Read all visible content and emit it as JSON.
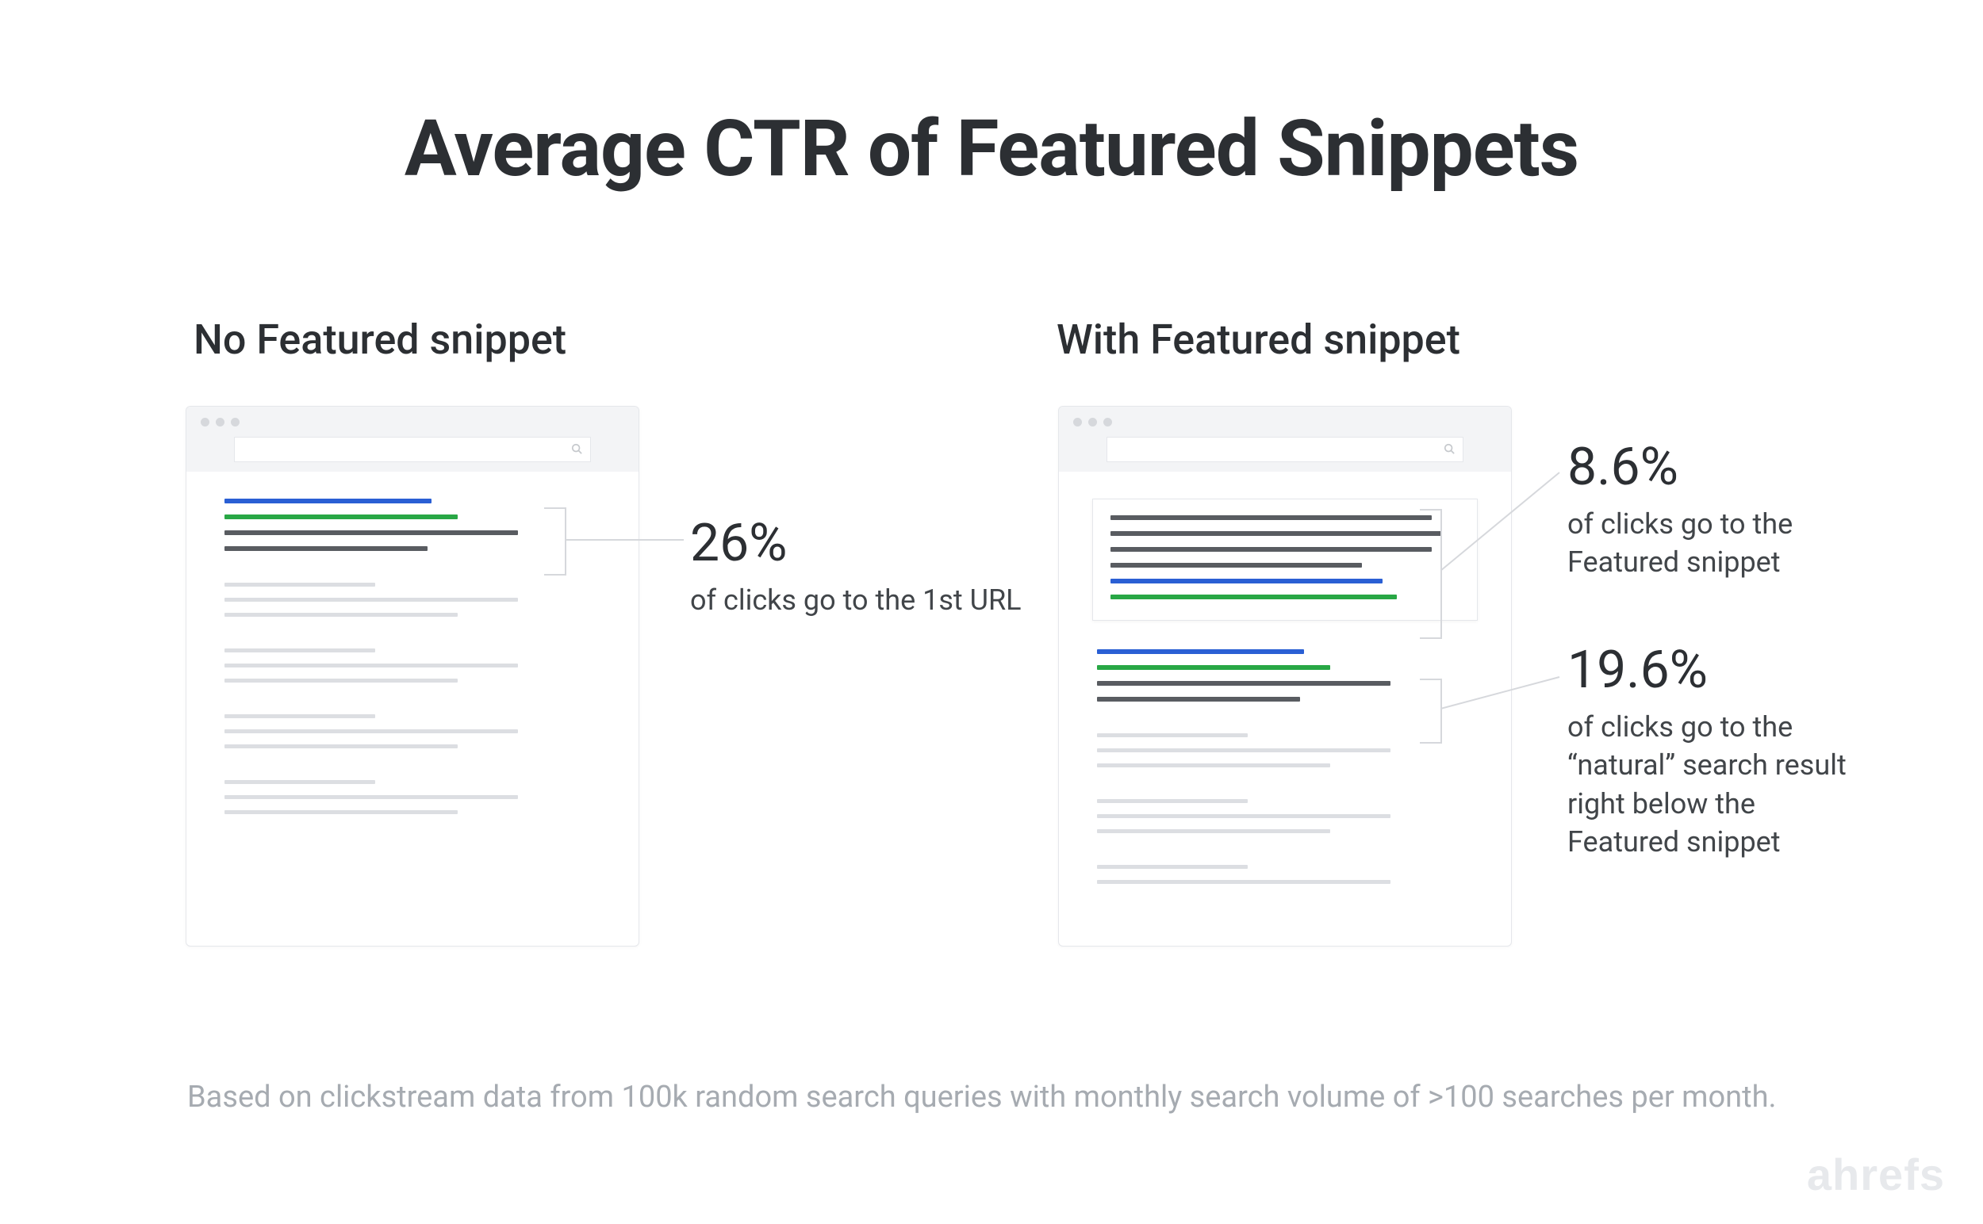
{
  "title": "Average CTR of Featured Snippets",
  "left": {
    "label": "No Featured snippet",
    "callout": {
      "value": "26%",
      "desc": "of clicks go to the 1st URL"
    }
  },
  "right": {
    "label": "With Featured snippet",
    "callout_top": {
      "value": "8.6%",
      "desc": "of clicks go to the Featured snippet"
    },
    "callout_bottom": {
      "value": "19.6%",
      "desc": "of clicks go to the “natural” search result right below the Featured snippet"
    }
  },
  "footnote": "Based on clickstream data from 100k random search queries with monthly search volume of >100 searches per month.",
  "brand": "ahrefs",
  "chart_data": {
    "type": "bar",
    "title": "Average CTR of Featured Snippets",
    "series": [
      {
        "name": "No Featured snippet",
        "items": [
          {
            "label": "1st URL",
            "ctr_percent": 26
          }
        ]
      },
      {
        "name": "With Featured snippet",
        "items": [
          {
            "label": "Featured snippet",
            "ctr_percent": 8.6
          },
          {
            "label": "Natural result below Featured snippet",
            "ctr_percent": 19.6
          }
        ]
      }
    ],
    "unit": "percent_ctr",
    "note": "Based on clickstream data from 100k random search queries with monthly search volume of >100 searches per month."
  }
}
